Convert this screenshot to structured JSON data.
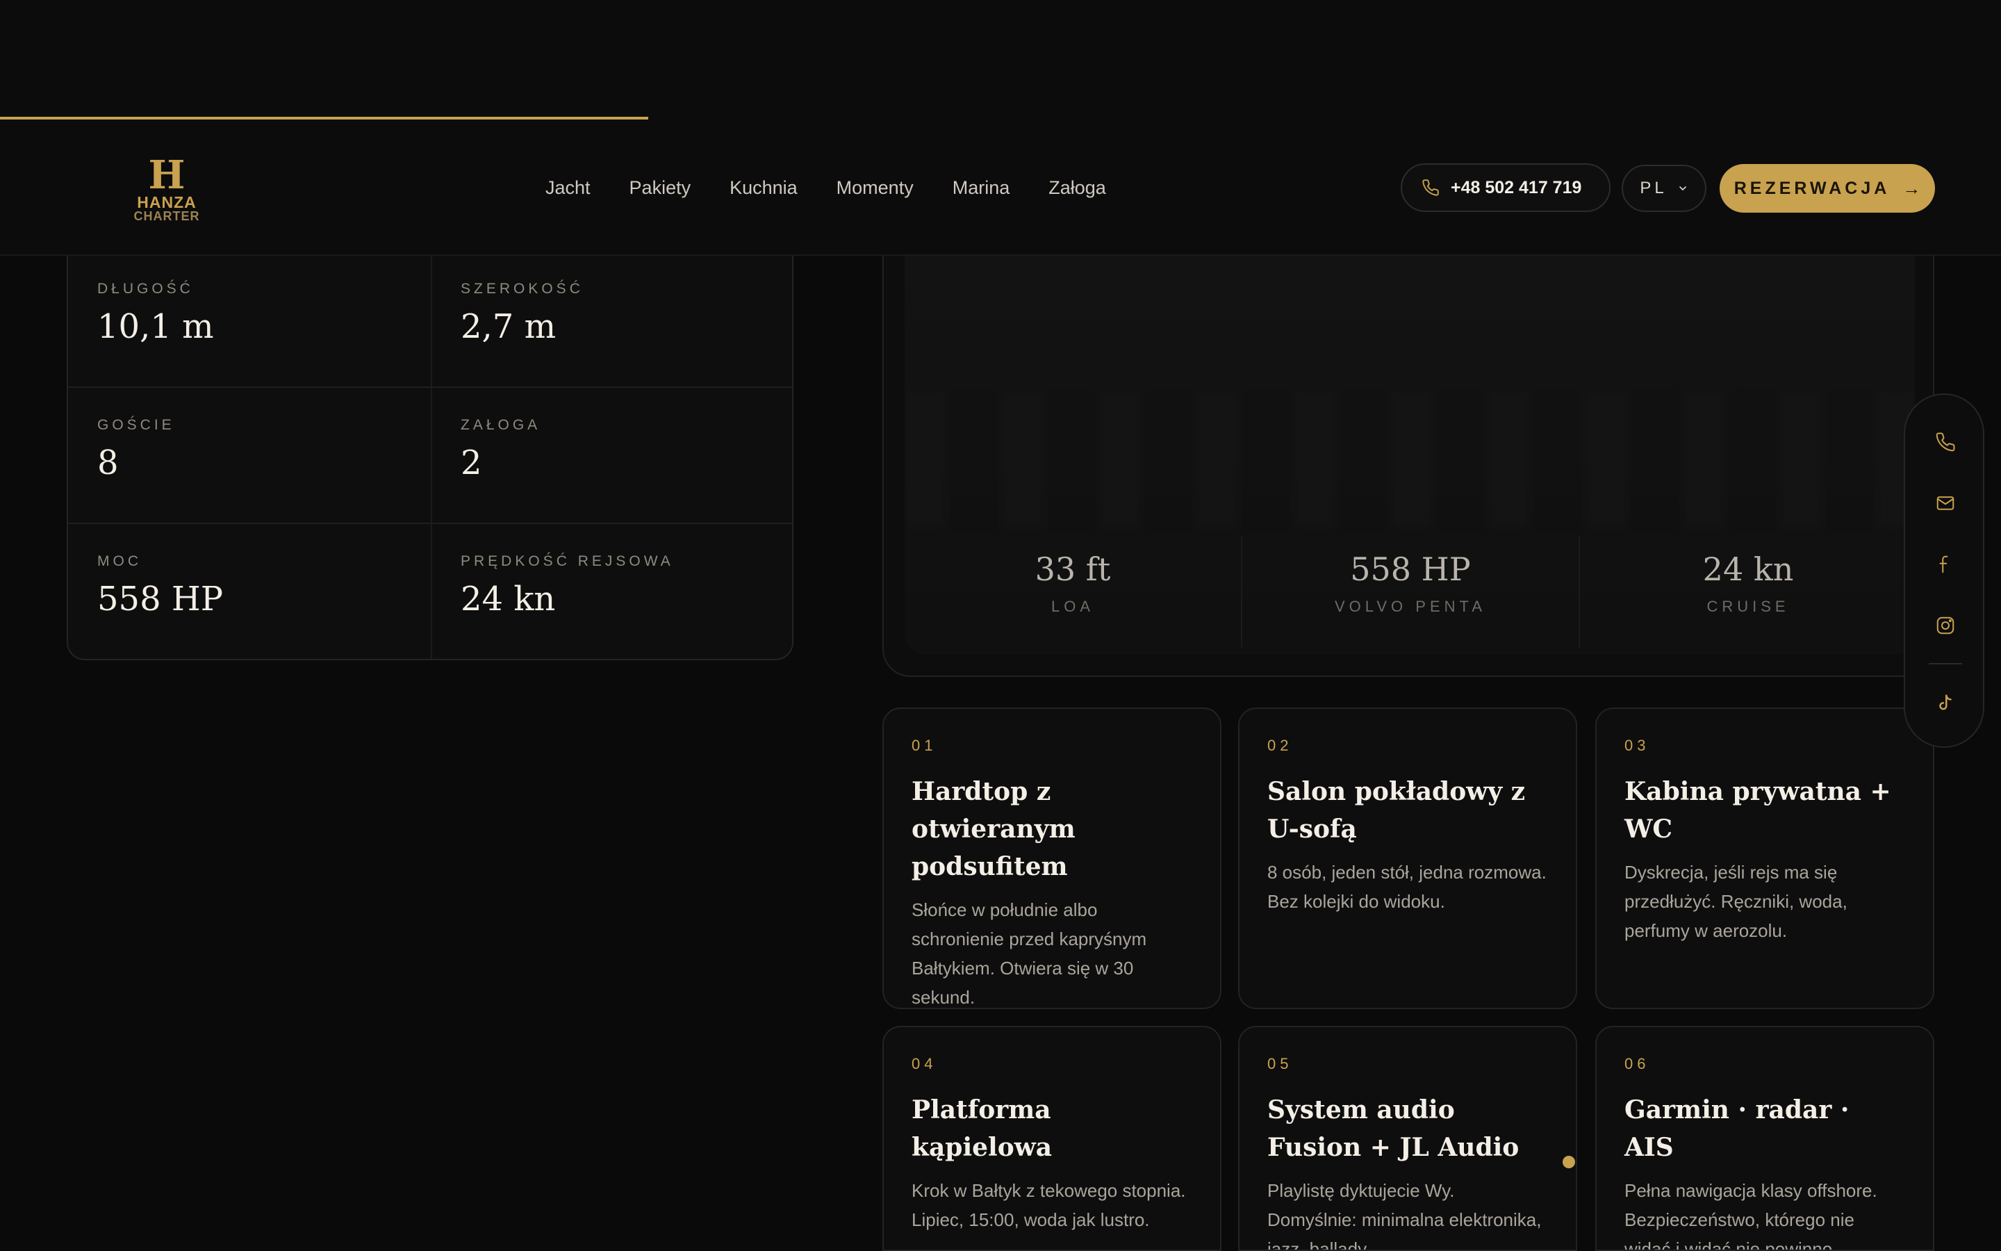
{
  "header": {
    "logo": {
      "line1": "HANZA",
      "line2": "CHARTER"
    },
    "nav": [
      "Jacht",
      "Pakiety",
      "Kuchnia",
      "Momenty",
      "Marina",
      "Załoga"
    ],
    "phone": "+48 502 417 719",
    "language": "PL",
    "cta": "REZERWACJA",
    "cta_arrow": "→"
  },
  "specs": [
    {
      "label": "DŁUGOŚĆ",
      "value": "10,1 m"
    },
    {
      "label": "SZEROKOŚĆ",
      "value": "2,7 m"
    },
    {
      "label": "GOŚCIE",
      "value": "8"
    },
    {
      "label": "ZAŁOGA",
      "value": "2"
    },
    {
      "label": "MOC",
      "value": "558 HP"
    },
    {
      "label": "PRĘDKOŚĆ REJSOWA",
      "value": "24 kn"
    }
  ],
  "hero_stats": [
    {
      "value": "33 ft",
      "caption": "LOA"
    },
    {
      "value": "558 HP",
      "caption": "VOLVO PENTA"
    },
    {
      "value": "24 kn",
      "caption": "CRUISE"
    }
  ],
  "features": [
    {
      "num": "01",
      "title": "Hardtop z otwieranym podsufitem",
      "desc": "Słońce w południe albo schronienie przed kapryśnym Bałtykiem. Otwiera się w 30 sekund."
    },
    {
      "num": "02",
      "title": "Salon pokładowy z U-sofą",
      "desc": "8 osób, jeden stół, jedna rozmowa. Bez kolejki do widoku."
    },
    {
      "num": "03",
      "title": "Kabina prywatna + WC",
      "desc": "Dyskrecja, jeśli rejs ma się przedłużyć. Ręczniki, woda, perfumy w aerozolu."
    },
    {
      "num": "04",
      "title": "Platforma kąpielowa",
      "desc": "Krok w Bałtyk z tekowego stopnia. Lipiec, 15:00, woda jak lustro."
    },
    {
      "num": "05",
      "title": "System audio Fusion + JL Audio",
      "desc": "Playlistę dyktujecie Wy. Domyślnie: minimalna elektronika, jazz, ballady."
    },
    {
      "num": "06",
      "title": "Garmin · radar · AIS",
      "desc": "Pełna nawigacja klasy offshore. Bezpieczeństwo, którego nie widać i widać nie powinno."
    }
  ],
  "icons": {
    "phone": "phone-icon",
    "chevron": "chevron-down-icon",
    "mail": "mail-icon",
    "facebook": "facebook-icon",
    "instagram": "instagram-icon",
    "tiktok": "tiktok-icon"
  },
  "colors": {
    "accent": "#c9a24f",
    "background": "#0a0a0a",
    "text": "#f4efe6"
  }
}
